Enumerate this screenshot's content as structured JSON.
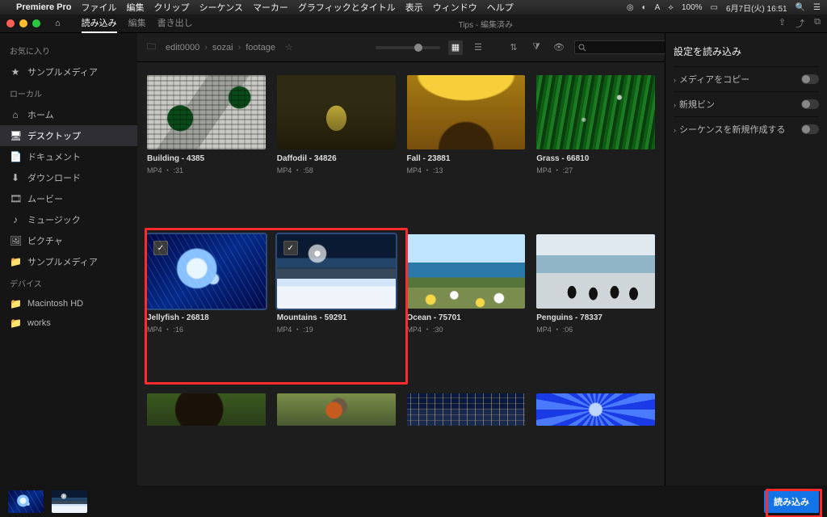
{
  "menubar": {
    "app": "Premiere Pro",
    "items": [
      "ファイル",
      "編集",
      "クリップ",
      "シーケンス",
      "マーカー",
      "グラフィックとタイトル",
      "表示",
      "ウィンドウ",
      "ヘルプ"
    ],
    "right": {
      "wifi": "100%",
      "battery": "",
      "date": "6月7日(火) 16:51"
    }
  },
  "chrome": {
    "tabs": [
      "読み込み",
      "編集",
      "書き出し"
    ],
    "active_tab": 0,
    "center": "Tips - 編集済み"
  },
  "sidebar": {
    "favorites_label": "お気に入り",
    "favorites": [
      {
        "icon": "★",
        "label": "サンプルメディア"
      }
    ],
    "local_label": "ローカル",
    "local": [
      {
        "icon": "⌂",
        "label": "ホーム"
      },
      {
        "icon": "🖥",
        "label": "デスクトップ",
        "active": true
      },
      {
        "icon": "📄",
        "label": "ドキュメント"
      },
      {
        "icon": "⬇",
        "label": "ダウンロード"
      },
      {
        "icon": "🎞",
        "label": "ムービー"
      },
      {
        "icon": "♪",
        "label": "ミュージック"
      },
      {
        "icon": "🖼",
        "label": "ピクチャ"
      },
      {
        "icon": "📁",
        "label": "サンプルメディア"
      }
    ],
    "devices_label": "デバイス",
    "devices": [
      {
        "icon": "📁",
        "label": "Macintosh HD"
      },
      {
        "icon": "📁",
        "label": "works"
      }
    ]
  },
  "toolbar": {
    "breadcrumbs": [
      "edit0000",
      "sozai",
      "footage"
    ],
    "search_placeholder": ""
  },
  "files": [
    {
      "name": "Building - 4385",
      "sub": "MP4 ・ :31",
      "thumb": "th-building"
    },
    {
      "name": "Daffodil - 34826",
      "sub": "MP4 ・ :58",
      "thumb": "th-daffodil"
    },
    {
      "name": "Fall - 23881",
      "sub": "MP4 ・ :13",
      "thumb": "th-fall"
    },
    {
      "name": "Grass - 66810",
      "sub": "MP4 ・ :27",
      "thumb": "th-grass"
    },
    {
      "name": "Jellyfish - 26818",
      "sub": "MP4 ・ :16",
      "thumb": "th-jelly",
      "selected": true
    },
    {
      "name": "Mountains - 59291",
      "sub": "MP4 ・ :19",
      "thumb": "th-mountains",
      "selected": true
    },
    {
      "name": "Ocean - 75701",
      "sub": "MP4 ・ :30",
      "thumb": "th-ocean"
    },
    {
      "name": "Penguins - 78337",
      "sub": "MP4 ・ :06",
      "thumb": "th-penguins"
    },
    {
      "name": "",
      "sub": "",
      "thumb": "th-puppy",
      "partial": true
    },
    {
      "name": "",
      "sub": "",
      "thumb": "th-bird",
      "partial": true
    },
    {
      "name": "",
      "sub": "",
      "thumb": "th-city",
      "partial": true
    },
    {
      "name": "",
      "sub": "",
      "thumb": "th-frost",
      "partial": true
    }
  ],
  "rightpanel": {
    "title": "設定を読み込み",
    "items": [
      {
        "label": "メディアをコピー"
      },
      {
        "label": "新規ビン"
      },
      {
        "label": "シーケンスを新規作成する"
      }
    ]
  },
  "footer": {
    "import_label": "読み込み"
  }
}
